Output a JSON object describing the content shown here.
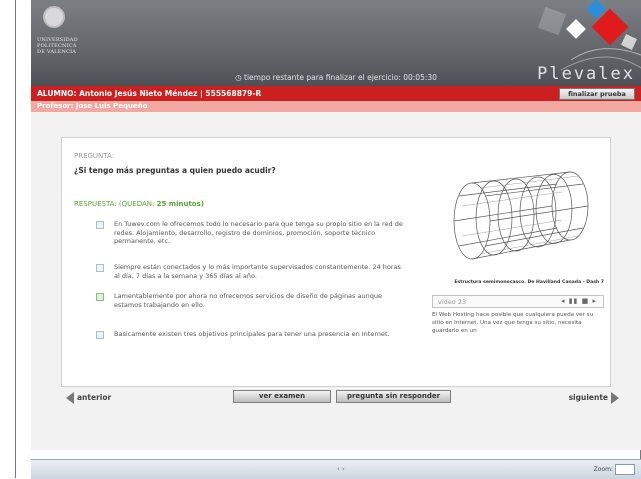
{
  "header": {
    "university_lines": [
      "UNIVERSIDAD",
      "POLITECNICA",
      "DE VALENCIA"
    ],
    "timer_text": "tiempo restante para finalizar el ejercicio: 00:05:30",
    "brand": "Plevalex",
    "accent_colors": [
      "#2a8fd8",
      "#e01b1b"
    ]
  },
  "student": {
    "info": "ALUMNO: Antonio Jesús Nieto Méndez   |   555568879-R",
    "finish_button": "finalizar prueba",
    "professor": "Profesor: Jose Luis Pequeño"
  },
  "question": {
    "label": "PREGUNTA:",
    "text": "¿Si tengo más preguntas a quien puedo acudir?",
    "answer_label": "RESPUESTA: (QUEDAN:",
    "answer_minutes": "25 minutos)"
  },
  "options": [
    {
      "text": "En Tuwev.com le ofrecemos todo lo necesario para que tenga su propio sitio en la red de redes. Alojamiento, desarrollo, registro de dominios, promoción, soporte técnico permanente, etc."
    },
    {
      "text": "Siempre están conectados y lo más importante supervisados constantemente. 24 horas al día, 7 días a la semana y 365 días al año."
    },
    {
      "text": "Lamentablemente por ahora no ofrecemos servicios de diseño de páginas aunque estamos trabajando en ello."
    },
    {
      "text": "Basicamente existen tres objetivos principales para tener una presencia en Internet."
    }
  ],
  "media": {
    "caption": "Estructura semimonocasco. De Havilland Canada - Dash 7",
    "video_label": "video 23",
    "video_controls": "◂ ▮▮ ■ ▸",
    "description": "El Web Hosting hace posible que cualquiera pueda ver su sitio en Internet. Una vez que tenga su sitio, necesita guardarlo en un"
  },
  "nav": {
    "previous": "anterior",
    "view_exam": "ver examen",
    "unanswered": "pregunta sin responder",
    "next": "siguiente"
  },
  "statusbar": {
    "scroll": "‹ ›",
    "zoom_label": "Zoom:"
  }
}
